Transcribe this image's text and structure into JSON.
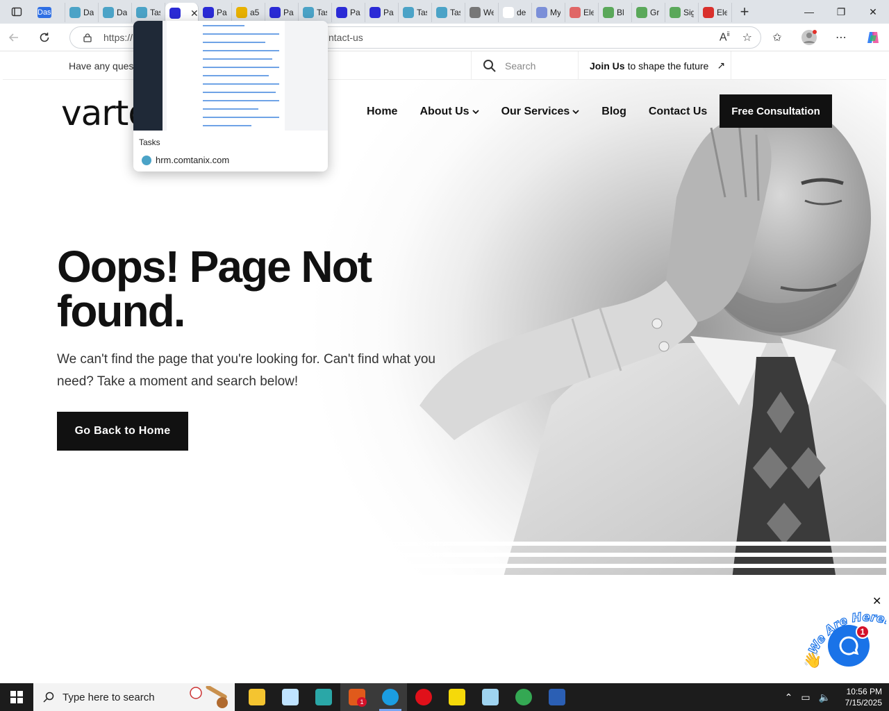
{
  "browser": {
    "tabs": [
      {
        "label": "Das",
        "favicon_color": "#2f6fe4",
        "first": true
      },
      {
        "label": "Da",
        "favicon_color": "#4ba3c7"
      },
      {
        "label": "Da",
        "favicon_color": "#4ba3c7"
      },
      {
        "label": "Tas",
        "favicon_color": "#4ba3c7"
      },
      {
        "label": "",
        "favicon_color": "#2b2bd6",
        "active": true
      },
      {
        "label": "Pa",
        "favicon_color": "#2b2bd6"
      },
      {
        "label": "a5",
        "favicon_color": "#e8b100"
      },
      {
        "label": "Pa",
        "favicon_color": "#2b2bd6"
      },
      {
        "label": "Tas",
        "favicon_color": "#4ba3c7"
      },
      {
        "label": "Pa",
        "favicon_color": "#2b2bd6"
      },
      {
        "label": "Pa",
        "favicon_color": "#2b2bd6"
      },
      {
        "label": "Tas",
        "favicon_color": "#4ba3c7"
      },
      {
        "label": "Tas",
        "favicon_color": "#4ba3c7"
      },
      {
        "label": "We",
        "favicon_color": "#777777"
      },
      {
        "label": "de",
        "favicon_color": "#ffffff"
      },
      {
        "label": "My",
        "favicon_color": "#7b8fd8"
      },
      {
        "label": "Ele",
        "favicon_color": "#e06666"
      },
      {
        "label": "Bl",
        "favicon_color": "#5aa85a"
      },
      {
        "label": "Gr",
        "favicon_color": "#5aa85a"
      },
      {
        "label": "Sig",
        "favicon_color": "#5aa85a"
      },
      {
        "label": "Ele",
        "favicon_color": "#d9302c"
      }
    ],
    "address": {
      "prefix": "https://",
      "suffix": "ntact-us"
    },
    "window_controls": {
      "minimize": "—",
      "restore": "❐",
      "close": "✕"
    }
  },
  "preview": {
    "title": "Tasks",
    "domain": "hrm.comtanix.com"
  },
  "site": {
    "topbar": {
      "question": "Have any ques",
      "search_placeholder": "Search",
      "join_bold": "Join Us",
      "join_rest": "to shape the future",
      "join_arrow": "↗"
    },
    "logo": "varto",
    "nav": [
      {
        "label": "Home",
        "dropdown": false
      },
      {
        "label": "About Us",
        "dropdown": true
      },
      {
        "label": "Our Services",
        "dropdown": true
      },
      {
        "label": "Blog",
        "dropdown": false
      },
      {
        "label": "Contact Us",
        "dropdown": false
      }
    ],
    "cta": "Free Consultation",
    "heading_line1": "Oops! Page Not",
    "heading_line2": "found.",
    "lead": "We can't find the page that you're looking for. Can't find what you need? Take a moment and search below!",
    "button": "Go Back to Home",
    "chat": {
      "close": "✕",
      "tagline": "We Are Here!",
      "badge": "1"
    }
  },
  "taskbar": {
    "search_placeholder": "Type here to search",
    "time": "10:56 PM",
    "date": "7/15/2025",
    "zoom_badge": "1",
    "apps": [
      {
        "name": "file-explorer",
        "color": "#f4c430"
      },
      {
        "name": "paint",
        "color": "#bfe3ff"
      },
      {
        "name": "app-diamond",
        "color": "#2aa7a7"
      },
      {
        "name": "zoom",
        "color": "#e05a1b"
      },
      {
        "name": "edge",
        "color": "#1b9de2"
      },
      {
        "name": "opera",
        "color": "#e0101a"
      },
      {
        "name": "sticky-notes",
        "color": "#f5d90a"
      },
      {
        "name": "notepad",
        "color": "#9fd4f0"
      },
      {
        "name": "chrome",
        "color": "#34a853"
      },
      {
        "name": "word",
        "color": "#2b5fb4"
      }
    ]
  }
}
